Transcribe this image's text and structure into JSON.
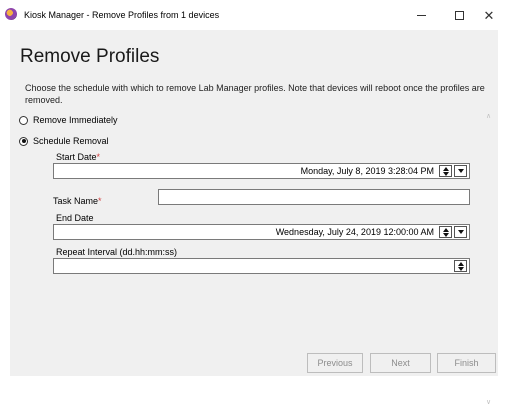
{
  "window": {
    "title": "Kiosk Manager - Remove Profiles from 1 devices",
    "minimize_glyph": "—",
    "close_glyph": "✕"
  },
  "page": {
    "title": "Remove Profiles",
    "description": "Choose the schedule with which to remove Lab Manager profiles. Note that devices will reboot once the profiles are removed."
  },
  "options": {
    "remove_immediately": {
      "label": "Remove Immediately",
      "checked": false
    },
    "schedule_removal": {
      "label": "Schedule Removal",
      "checked": true
    }
  },
  "form": {
    "start_date": {
      "label": "Start Date",
      "required_mark": "*",
      "value": "Monday, July 8, 2019 3:28:04 PM"
    },
    "task_name": {
      "label": "Task Name",
      "required_mark": "*",
      "value": ""
    },
    "end_date": {
      "label": "End Date",
      "value": "Wednesday, July 24, 2019 12:00:00 AM"
    },
    "repeat_interval": {
      "label": "Repeat Interval (dd.hh:mm:ss)",
      "value": ""
    }
  },
  "footer": {
    "previous_label": "Previous",
    "next_label": "Next",
    "finish_label": "Finish"
  }
}
